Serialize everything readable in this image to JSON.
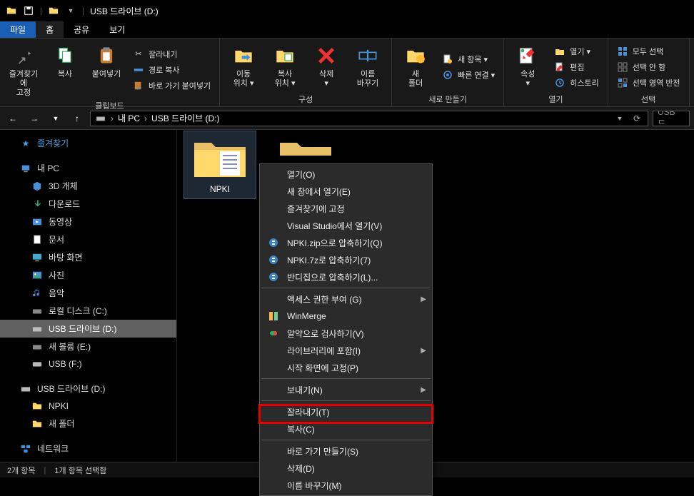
{
  "titlebar": {
    "title": "USB 드라이브 (D:)"
  },
  "menutabs": {
    "file": "파일",
    "home": "홈",
    "share": "공유",
    "view": "보기"
  },
  "ribbon": {
    "clipboard": {
      "label": "클립보드",
      "pin": "즐겨찾기에\n고정",
      "copy": "복사",
      "paste": "붙여넣기",
      "cut": "잘라내기",
      "copypath": "경로 복사",
      "pasteshortcut": "바로 가기 붙여넣기"
    },
    "organize": {
      "label": "구성",
      "moveto": "이동\n위치 ▾",
      "copyto": "복사\n위치 ▾",
      "delete": "삭제\n▾",
      "rename": "이름\n바꾸기"
    },
    "new": {
      "label": "새로 만들기",
      "newfolder": "새\n폴더",
      "newitem": "새 항목 ▾",
      "easyaccess": "빠른 연결 ▾"
    },
    "open": {
      "label": "열기",
      "properties": "속성\n▾",
      "open": "열기 ▾",
      "edit": "편집",
      "history": "히스토리"
    },
    "select": {
      "label": "선택",
      "selectall": "모두 선택",
      "selectnone": "선택 안 함",
      "invert": "선택 영역 반전"
    }
  },
  "address": {
    "crumb1": "내 PC",
    "crumb2": "USB 드라이브 (D:)",
    "search_placeholder": "USB 드"
  },
  "sidebar": {
    "quickaccess": "즐겨찾기",
    "thispc": "내 PC",
    "objects3d": "3D 개체",
    "downloads": "다운로드",
    "videos": "동영상",
    "documents": "문서",
    "desktop": "바탕 화면",
    "pictures": "사진",
    "music": "음악",
    "localdisk": "로컬 디스크 (C:)",
    "usbd": "USB 드라이브 (D:)",
    "newvol": "새 볼륨 (E:)",
    "usbf": "USB (F:)",
    "usbd2": "USB 드라이브 (D:)",
    "npki": "NPKI",
    "newfolder": "새 폴더",
    "network": "네트워크"
  },
  "files": {
    "item1": "NPKI",
    "item2": ""
  },
  "context": {
    "open": "열기(O)",
    "opennew": "새 창에서 열기(E)",
    "pin": "즐겨찾기에 고정",
    "vs": "Visual Studio에서 열기(V)",
    "zip": "NPKI.zip으로 압축하기(Q)",
    "7z": "NPKI.7z로 압축하기(7)",
    "bandizip": "반디집으로 압축하기(L)...",
    "access": "액세스 권한 부여 (G)",
    "winmerge": "WinMerge",
    "alyac": "알약으로 검사하기(V)",
    "library": "라이브러리에 포함(I)",
    "pinstart": "시작 화면에 고정(P)",
    "sendto": "보내기(N)",
    "cut": "잘라내기(T)",
    "copy": "복사(C)",
    "shortcut": "바로 가기 만들기(S)",
    "delete": "삭제(D)",
    "rename": "이름 바꾸기(M)"
  },
  "status": {
    "count": "2개 항목",
    "selected": "1개 항목 선택함"
  },
  "colors": {
    "accent": "#1a5fb4",
    "highlight": "#e60000"
  }
}
